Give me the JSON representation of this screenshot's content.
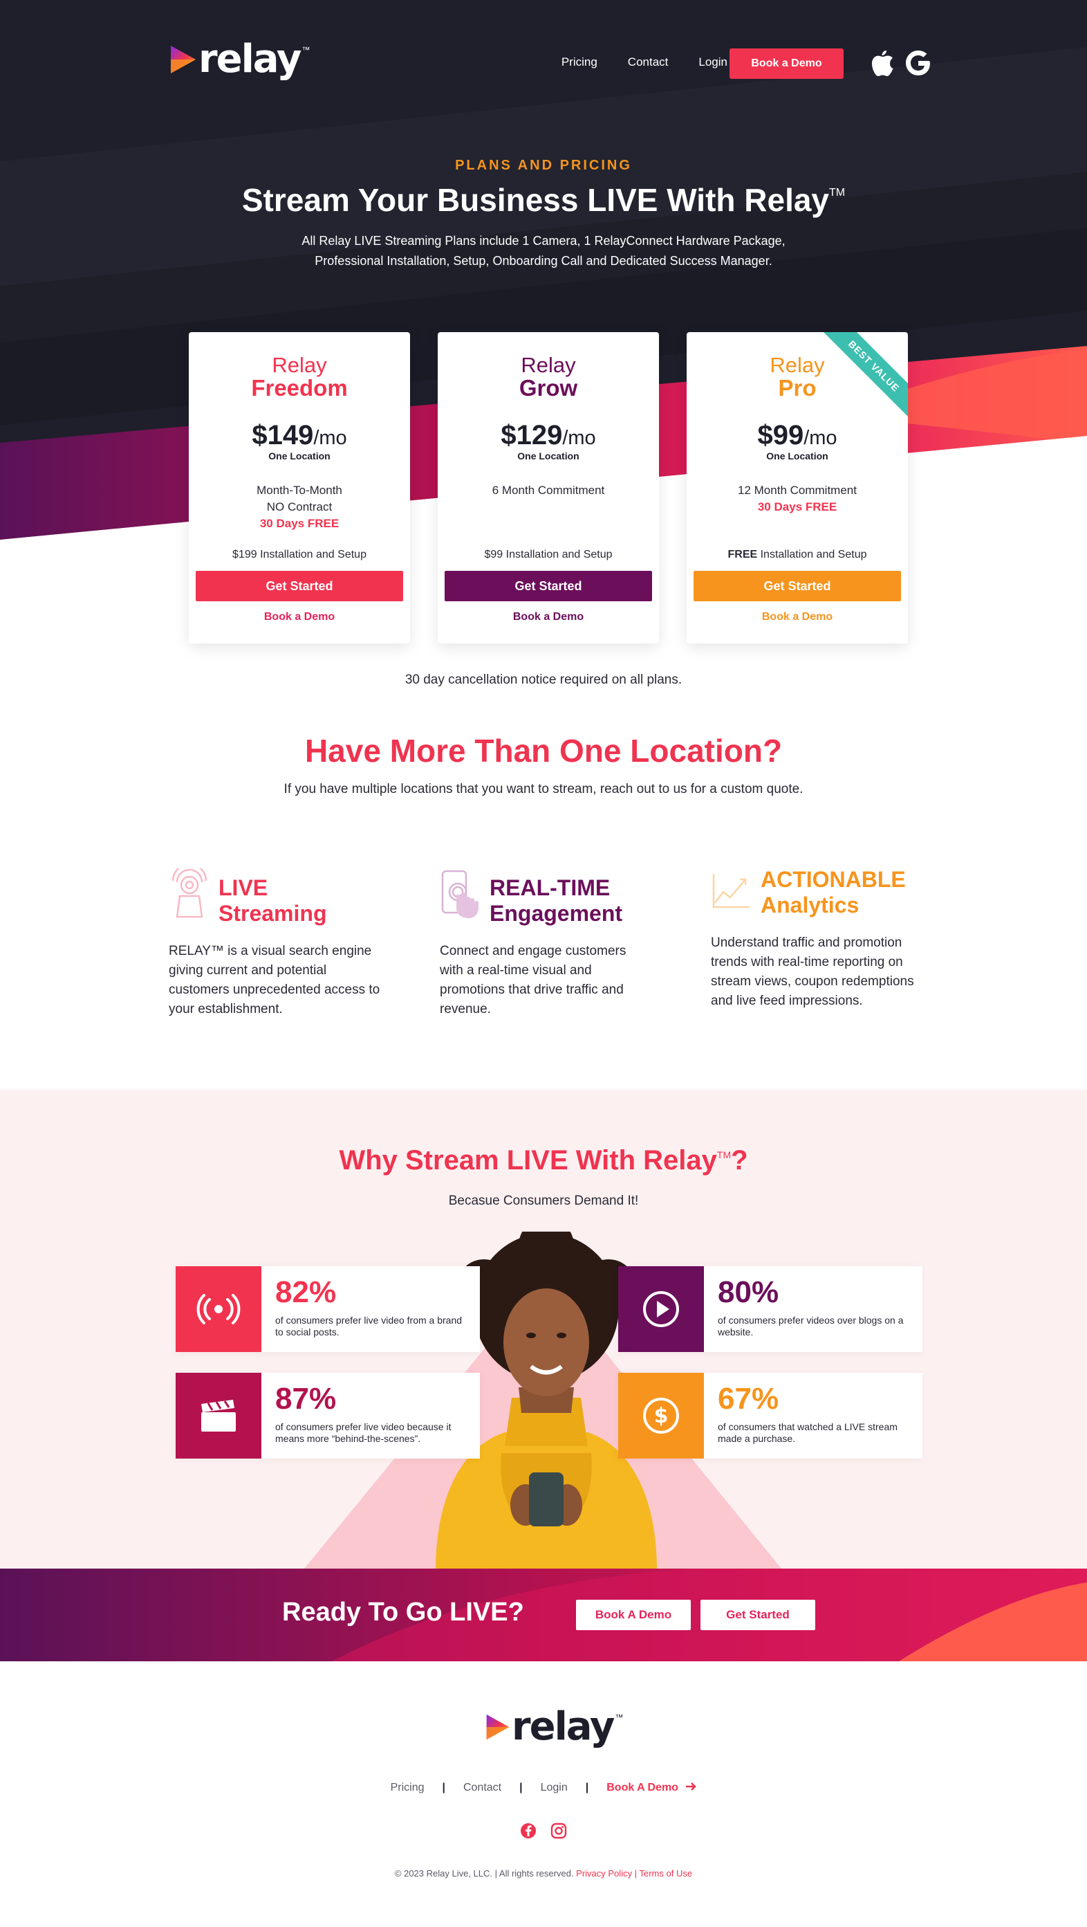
{
  "nav": {
    "logo": "relay",
    "logo_tm": "™",
    "links": [
      "Pricing",
      "Contact",
      "Login"
    ],
    "demo_button": "Book a Demo",
    "icons": [
      "apple-icon",
      "google-icon"
    ]
  },
  "hero": {
    "eyebrow": "PLANS AND PRICING",
    "title": "Stream Your Business LIVE With Relay",
    "title_tm": "TM",
    "subtitle_line1": "All Relay LIVE Streaming Plans include 1 Camera, 1 RelayConnect Hardware Package,",
    "subtitle_line2": "Professional Installation, Setup, Onboarding Call and Dedicated Success Manager."
  },
  "plans": [
    {
      "relay": "Relay",
      "name": "Freedom",
      "price": "$149",
      "per": "/mo",
      "location": "One Location",
      "term1": "Month-To-Month",
      "term2": "NO Contract",
      "free": "30 Days FREE",
      "setup_bold": "",
      "setup": "$199 Installation and Setup",
      "button": "Get Started",
      "demo": "Book a Demo",
      "color": "#f2334f"
    },
    {
      "relay": "Relay",
      "name": "Grow",
      "price": "$129",
      "per": "/mo",
      "location": "One Location",
      "term1": "6 Month Commitment",
      "term2": "",
      "free": "",
      "setup_bold": "",
      "setup": "$99 Installation and Setup",
      "button": "Get Started",
      "demo": "Book a Demo",
      "color": "#6b0f5b"
    },
    {
      "relay": "Relay",
      "name": "Pro",
      "price": "$99",
      "per": "/mo",
      "location": "One Location",
      "term1": "12 Month Commitment",
      "term2": "",
      "free": "30 Days FREE",
      "setup_bold": "FREE",
      "setup": " Installation and Setup",
      "button": "Get Started",
      "demo": "Book a Demo",
      "color": "#f7941d",
      "ribbon": "BEST VALUE"
    }
  ],
  "cancel_note": "30 day cancellation notice required on all plans.",
  "multi": {
    "title": "Have More Than One Location?",
    "subtitle": "If you have multiple locations that you want to stream, reach out to us for a custom quote."
  },
  "features": [
    {
      "title1": "LIVE",
      "title2": "Streaming",
      "body": "RELAY™ is a visual search engine giving current and potential customers unprecedented access to your establishment.",
      "color": "#ef3450",
      "icon": "camera-icon"
    },
    {
      "title1": "REAL-TIME",
      "title2": "Engagement",
      "body": "Connect and engage customers with a real-time visual and promotions that drive traffic and revenue.",
      "color": "#6b0f5b",
      "icon": "phone-tap-icon"
    },
    {
      "title1": "ACTIONABLE",
      "title2": "Analytics",
      "body": "Understand traffic and promotion trends with real-time reporting on stream views, coupon redemptions and live feed impressions.",
      "color": "#f7941d",
      "icon": "line-chart-icon"
    }
  ],
  "why": {
    "title": "Why Stream LIVE With Relay",
    "title_tm": "TM",
    "title_end": "?",
    "subtitle": "Becasue Consumers Demand It!",
    "stats": [
      {
        "pct": "82%",
        "text": "of consumers prefer live video from a brand to social posts.",
        "color": "#f2334f",
        "icon": "broadcast-icon"
      },
      {
        "pct": "80%",
        "text": "of consumers prefer videos over blogs on a website.",
        "color": "#6b0f5b",
        "icon": "play-icon"
      },
      {
        "pct": "87%",
        "text": "of consumers prefer live video because it means more “behind-the-scenes”.",
        "color": "#b3124f",
        "icon": "clapperboard-icon"
      },
      {
        "pct": "67%",
        "text": "of consumers that watched a LIVE stream made a purchase.",
        "color": "#f7941d",
        "icon": "dollar-icon"
      }
    ]
  },
  "cta": {
    "title": "Ready To Go LIVE?",
    "demo_button": "Book A Demo",
    "start_button": "Get Started"
  },
  "footer": {
    "logo": "relay",
    "logo_tm": "™",
    "links": [
      "Pricing",
      "Contact",
      "Login"
    ],
    "demo_link": "Book A Demo",
    "sep": "|",
    "social": [
      "facebook-icon",
      "instagram-icon"
    ],
    "copyright": "© 2023 Relay Live, LLC. | All rights reserved.",
    "privacy": "Privacy Policy",
    "terms": "Terms of Use"
  }
}
